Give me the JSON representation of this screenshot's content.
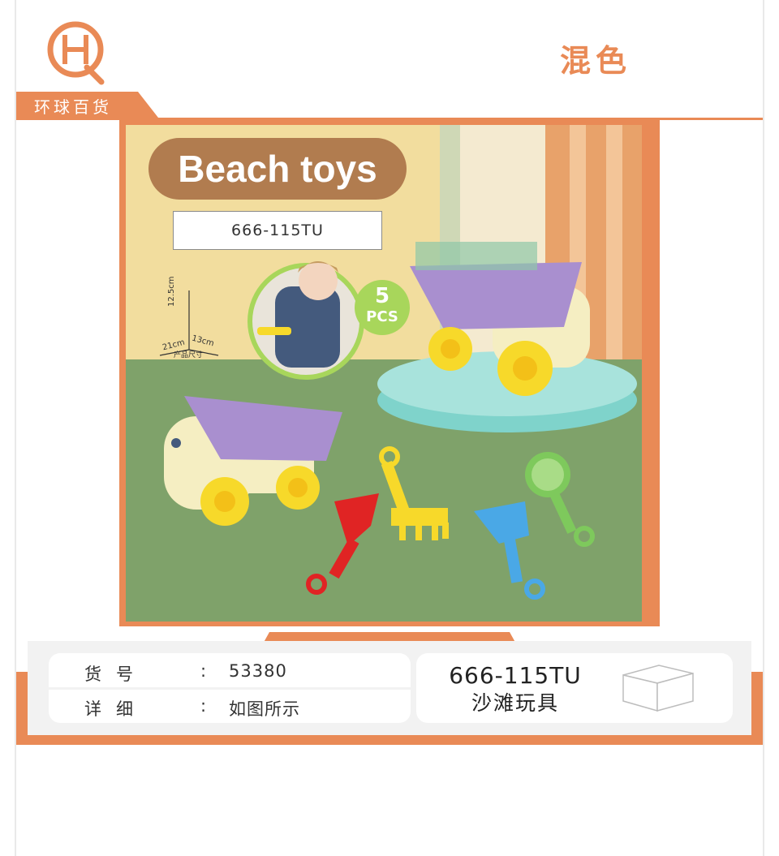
{
  "brand": {
    "logo_letters": "HQ",
    "name": "环球百货"
  },
  "color_label": "混色",
  "product_image": {
    "title": "Beach toys",
    "model": "666-115TU",
    "pcs_count": "5",
    "pcs_label": "PCS",
    "dimensions": {
      "height": "12.5cm",
      "length": "21cm",
      "width": "13cm",
      "caption": "产品尺寸"
    }
  },
  "info": {
    "item_no_label": "货号",
    "item_no_value": "53380",
    "detail_label": "详细",
    "detail_value": "如图所示",
    "colon": ":",
    "model_code": "666-115TU",
    "product_name": "沙滩玩具"
  },
  "colors": {
    "accent_orange": "#e98a56",
    "title_pill": "#b17c4f",
    "wall_yellow": "#f2dd9e",
    "floor_green": "#7fa26a",
    "badge_green": "#a8d65b"
  }
}
